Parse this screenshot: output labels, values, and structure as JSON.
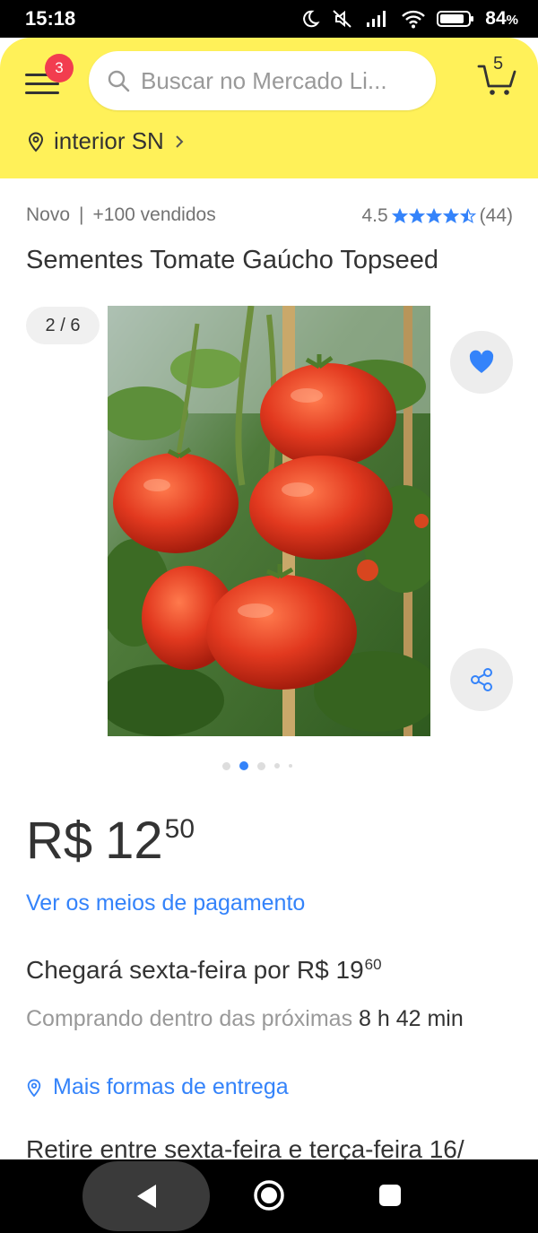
{
  "status_bar": {
    "time": "15:18",
    "battery_percent": "84",
    "battery_suffix": "%"
  },
  "header": {
    "menu_badge": "3",
    "search_placeholder": "Buscar no Mercado Li...",
    "cart_count": "5",
    "location": "interior SN"
  },
  "product": {
    "condition": "Novo",
    "separator": "|",
    "sold": "+100 vendidos",
    "rating_value": "4.5",
    "rating_stars": 4.5,
    "rating_count": "(44)",
    "title": "Sementes Tomate Gaúcho Topseed",
    "image_counter": "2 / 6",
    "carousel_current": 2,
    "carousel_total": 6,
    "price_currency": "R$",
    "price_integer": "12",
    "price_cents": "50",
    "payment_link": "Ver os meios de pagamento"
  },
  "shipping": {
    "title_prefix": "Chegará sexta-feira por R$ 19",
    "title_cents": "60",
    "sub_prefix": "Comprando dentro das próximas ",
    "sub_strong": "8 h 42 min",
    "more_link": "Mais formas de entrega",
    "pickup_partial": "Retire entre sexta-feira e terça-feira 16/"
  },
  "colors": {
    "header_yellow": "#fff159",
    "link_blue": "#3483fa",
    "badge_red": "#f23d4f",
    "tomato_red": "#e2391f"
  },
  "icons": {
    "menu": "hamburger-icon",
    "search": "search-icon",
    "cart": "cart-icon",
    "location": "location-pin-icon",
    "favorite": "heart-icon",
    "share": "share-icon"
  }
}
